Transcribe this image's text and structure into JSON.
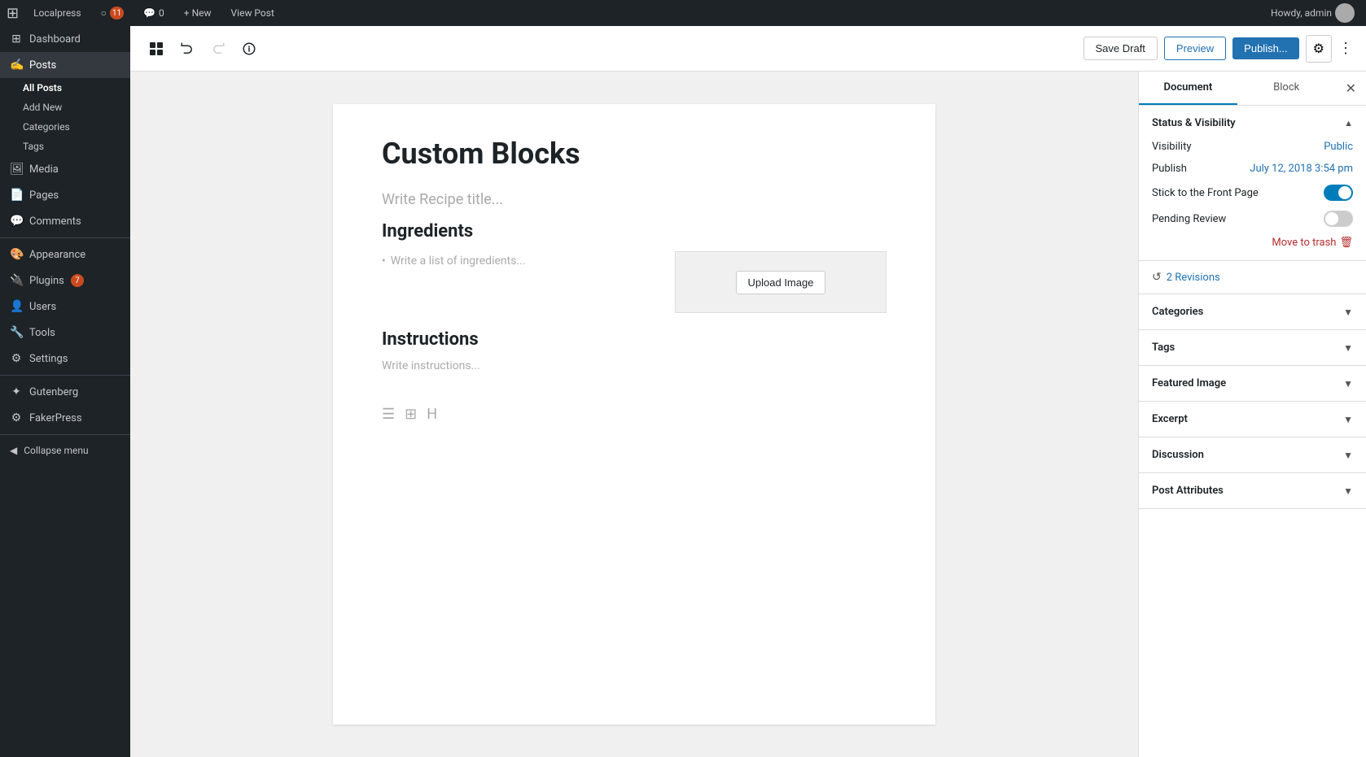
{
  "adminbar": {
    "logo": "⚙",
    "site_name": "Localpress",
    "updates_count": "11",
    "comments_count": "0",
    "new_label": "+ New",
    "view_post_label": "View Post",
    "user_greeting": "Howdy, admin"
  },
  "sidebar": {
    "dashboard_label": "Dashboard",
    "posts_label": "Posts",
    "all_posts_label": "All Posts",
    "add_new_label": "Add New",
    "categories_label": "Categories",
    "tags_label": "Tags",
    "media_label": "Media",
    "pages_label": "Pages",
    "comments_label": "Comments",
    "appearance_label": "Appearance",
    "plugins_label": "Plugins",
    "plugins_badge": "7",
    "users_label": "Users",
    "tools_label": "Tools",
    "settings_label": "Settings",
    "gutenberg_label": "Gutenberg",
    "fakerpress_label": "FakerPress",
    "collapse_label": "Collapse menu"
  },
  "toolbar": {
    "save_draft_label": "Save Draft",
    "preview_label": "Preview",
    "publish_label": "Publish...",
    "settings_label": "⚙",
    "more_label": "⋮"
  },
  "editor": {
    "post_title": "Custom Blocks",
    "recipe_title_placeholder": "Write Recipe title...",
    "ingredients_heading": "Ingredients",
    "ingredient_placeholder": "Write a list of ingredients...",
    "instructions_heading": "Instructions",
    "instructions_placeholder": "Write instructions...",
    "upload_image_label": "Upload Image"
  },
  "right_panel": {
    "document_tab": "Document",
    "block_tab": "Block",
    "status_section_title": "Status & Visibility",
    "visibility_label": "Visibility",
    "visibility_value": "Public",
    "publish_label": "Publish",
    "publish_value": "July 12, 2018 3:54 pm",
    "stick_to_front_label": "Stick to the Front Page",
    "pending_review_label": "Pending Review",
    "move_to_trash_label": "Move to trash",
    "revisions_label": "2 Revisions",
    "categories_title": "Categories",
    "tags_title": "Tags",
    "featured_image_title": "Featured Image",
    "excerpt_title": "Excerpt",
    "discussion_title": "Discussion",
    "post_attributes_title": "Post Attributes"
  }
}
